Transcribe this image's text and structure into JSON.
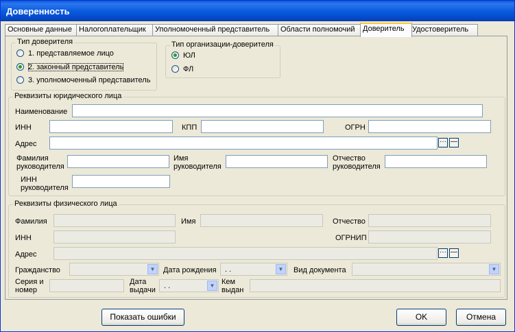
{
  "window": {
    "title": "Доверенность"
  },
  "tabs": [
    "Основные данные",
    "Налогоплательщик",
    "Уполномоченный представитель",
    "Области полномочий",
    "Доверитель",
    "Удостоверитель"
  ],
  "active_tab": "Доверитель",
  "principal_type": {
    "title": "Тип доверителя",
    "options": [
      "1. представляемое лицо",
      "2. законный представитель",
      "3. уполномоченный представитель"
    ],
    "selected": 1
  },
  "org_type": {
    "title": "Тип организации-доверителя",
    "options": [
      "ЮЛ",
      "ФЛ"
    ],
    "selected": 0
  },
  "legal": {
    "title": "Реквизиты юридического лица",
    "name": "Наименование",
    "inn": "ИНН",
    "kpp": "КПП",
    "ogrn": "ОГРН",
    "address": "Адрес",
    "head_last": "Фамилия",
    "head_last2": "руководителя",
    "head_first": "Имя",
    "head_first2": "руководителя",
    "head_middle": "Отчество",
    "head_middle2": "руководителя",
    "head_inn": "ИНН",
    "head_inn2": "руководителя"
  },
  "physical": {
    "title": "Реквизиты физического лица",
    "last": "Фамилия",
    "first": "Имя",
    "middle": "Отчество",
    "inn": "ИНН",
    "ogrnip": "ОГРНИП",
    "address": "Адрес",
    "citizenship": "Гражданство",
    "birth_date": "Дата рождения",
    "birth_date_value": " . .",
    "doc_type": "Вид документа",
    "series1": "Серия и",
    "series2": "номер",
    "issue1": "Дата",
    "issue2": "выдачи",
    "issue_value": " . .",
    "issued_by1": "Кем",
    "issued_by2": "выдан"
  },
  "buttons": {
    "show_errors": "Показать ошибки",
    "ok": "OK",
    "cancel": "Отмена",
    "ellipsis": "···",
    "minus": "—"
  }
}
